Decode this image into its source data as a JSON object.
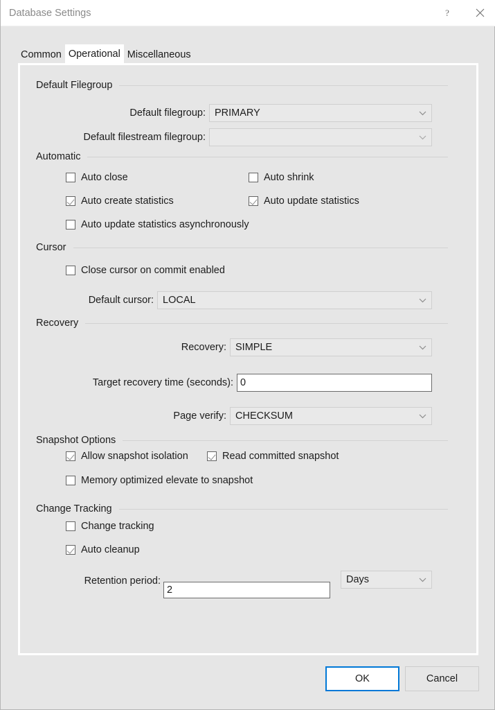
{
  "window": {
    "title": "Database Settings",
    "help_icon": "question-mark-icon",
    "close_icon": "close-icon"
  },
  "tabs": [
    {
      "label": "Common",
      "active": false
    },
    {
      "label": "Operational",
      "active": true
    },
    {
      "label": "Miscellaneous",
      "active": false
    }
  ],
  "groups": {
    "default_filegroup": "Default Filegroup",
    "automatic": "Automatic",
    "cursor": "Cursor",
    "recovery": "Recovery",
    "snapshot_options": "Snapshot Options",
    "change_tracking": "Change Tracking"
  },
  "fields": {
    "default_filegroup": {
      "label": "Default filegroup:",
      "value": "PRIMARY"
    },
    "default_filestream_filegroup": {
      "label": "Default filestream filegroup:",
      "value": ""
    },
    "default_cursor": {
      "label": "Default cursor:",
      "value": "LOCAL"
    },
    "recovery": {
      "label": "Recovery:",
      "value": "SIMPLE"
    },
    "target_recovery_time": {
      "label": "Target recovery time (seconds):",
      "value": "0"
    },
    "page_verify": {
      "label": "Page verify:",
      "value": "CHECKSUM"
    },
    "retention_period": {
      "label": "Retention period:",
      "value": "2"
    },
    "retention_units": {
      "value": "Days"
    }
  },
  "checkboxes": {
    "auto_close": {
      "label": "Auto close",
      "checked": false
    },
    "auto_shrink": {
      "label": "Auto shrink",
      "checked": false
    },
    "auto_create_statistics": {
      "label": "Auto create statistics",
      "checked": true
    },
    "auto_update_statistics": {
      "label": "Auto update statistics",
      "checked": true
    },
    "auto_update_statistics_async": {
      "label": "Auto update statistics asynchronously",
      "checked": false
    },
    "close_cursor_on_commit": {
      "label": "Close cursor on commit enabled",
      "checked": false
    },
    "allow_snapshot_isolation": {
      "label": "Allow snapshot isolation",
      "checked": true
    },
    "read_committed_snapshot": {
      "label": "Read committed snapshot",
      "checked": true
    },
    "memory_optimized_elevate": {
      "label": "Memory optimized elevate to snapshot",
      "checked": false
    },
    "change_tracking": {
      "label": "Change tracking",
      "checked": false
    },
    "auto_cleanup": {
      "label": "Auto cleanup",
      "checked": true
    }
  },
  "footer": {
    "ok": "OK",
    "cancel": "Cancel"
  },
  "colors": {
    "accent": "#0078d7",
    "window_bg": "#e6e6e6",
    "titlebar_bg": "#ffffff",
    "text": "#1c1c1c",
    "title_text": "#8a8a8a",
    "combo_bg": "#e9e9e9",
    "check_mark": "#8d8d8d"
  }
}
